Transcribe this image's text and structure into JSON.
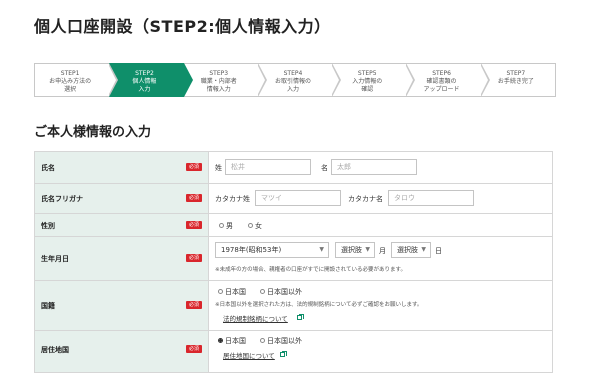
{
  "page": {
    "title": "個人口座開設（STEP2:個人情報入力）"
  },
  "steps": [
    {
      "label": "STEP1\nお申込み方法の\n選択",
      "active": false
    },
    {
      "label": "STEP2\n個人情報\n入力",
      "active": true
    },
    {
      "label": "STEP3\n職業・内部者\n情報入力",
      "active": false
    },
    {
      "label": "STEP4\nお取引情報の\n入力",
      "active": false
    },
    {
      "label": "STEP5\n入力情報の\n確認",
      "active": false
    },
    {
      "label": "STEP6\n確認書類の\nアップロード",
      "active": false
    },
    {
      "label": "STEP7\nお手続き完了",
      "active": false
    }
  ],
  "section": {
    "title": "ご本人様情報の入力"
  },
  "required_badge": "必須",
  "form": {
    "name": {
      "label": "氏名",
      "sei_label": "姓",
      "sei_placeholder": "松井",
      "mei_label": "名",
      "mei_placeholder": "太郎"
    },
    "kana": {
      "label": "氏名フリガナ",
      "sei_label": "カタカナ姓",
      "sei_placeholder": "マツイ",
      "mei_label": "カタカナ名",
      "mei_placeholder": "タロウ"
    },
    "gender": {
      "label": "性別",
      "options": [
        "男",
        "女"
      ]
    },
    "birthdate": {
      "label": "生年月日",
      "year_value": "1978年(昭和53年)",
      "month_value": "選択肢",
      "month_unit": "月",
      "day_value": "選択肢",
      "day_unit": "日",
      "note": "※未成年の方の場合、親権者の口座がすでに開設されている必要があります。"
    },
    "nationality": {
      "label": "国籍",
      "options": [
        "日本国",
        "日本国以外"
      ],
      "note": "※日本国以外を選択された方は、法的規制銘柄について必ずご確認をお願いします。",
      "link": "法的規制銘柄について"
    },
    "residence": {
      "label": "居住地国",
      "options": [
        "日本国",
        "日本国以外"
      ],
      "selected": "日本国",
      "link": "居住地国について"
    }
  },
  "colors": {
    "accent": "#0f8f6a",
    "required": "#d9262c",
    "label_bg": "#e6f0ec"
  }
}
